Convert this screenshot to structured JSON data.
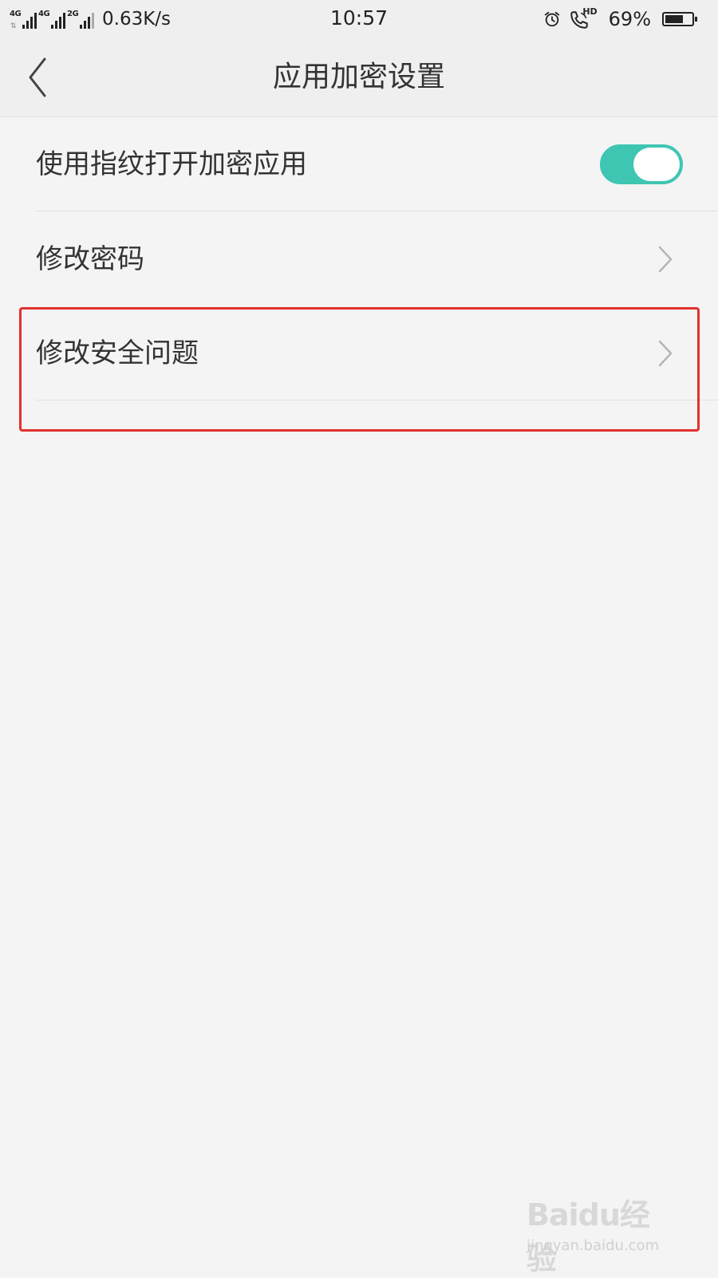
{
  "status_bar": {
    "sim1_network": "4G",
    "sim2_network": "4G",
    "sim3_network": "2G",
    "speed": "0.63K/s",
    "time": "10:57",
    "call_tag": "HD",
    "battery_percent": "69%",
    "battery_level": 0.69
  },
  "header": {
    "title": "应用加密设置",
    "back_icon": "chevron-left-icon"
  },
  "settings": {
    "fingerprint": {
      "label": "使用指纹打开加密应用",
      "enabled": true,
      "toggle_color": "#3fc6b3"
    },
    "change_password": {
      "label": "修改密码"
    },
    "change_security_question": {
      "label": "修改安全问题"
    }
  },
  "colors": {
    "highlight": "#e2312d",
    "background": "#f4f4f4"
  },
  "watermark": {
    "logo": "Baidu经验",
    "url": "jingyan.baidu.com"
  }
}
